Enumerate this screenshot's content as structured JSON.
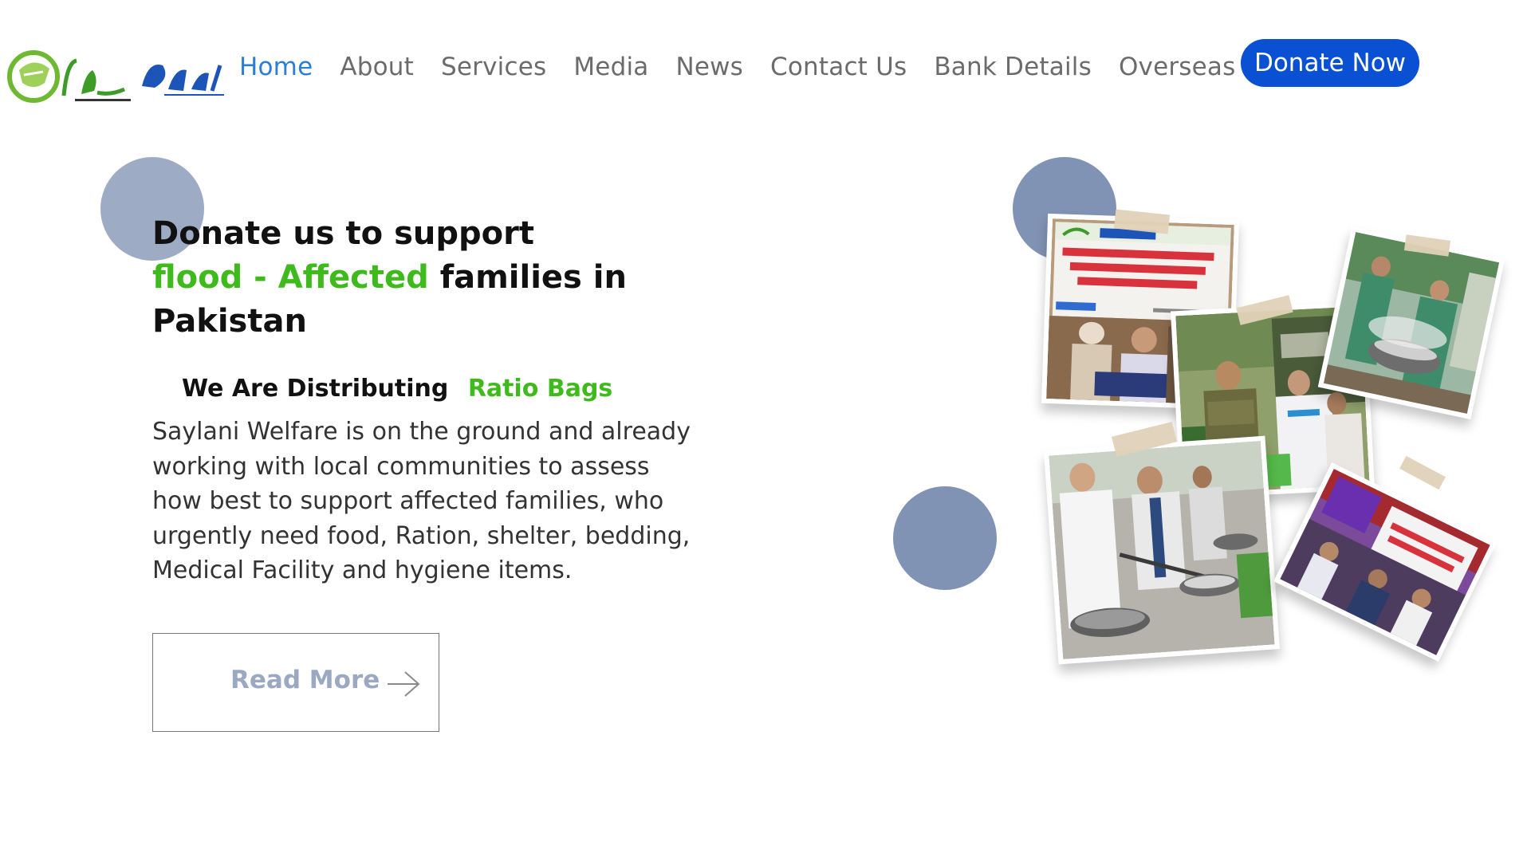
{
  "brand": {
    "logo_icon": "saylani-logo-icon"
  },
  "nav": {
    "items": [
      {
        "label": "Home",
        "active": true
      },
      {
        "label": "About",
        "active": false
      },
      {
        "label": "Services",
        "active": false
      },
      {
        "label": "Media",
        "active": false
      },
      {
        "label": "News",
        "active": false
      },
      {
        "label": "Contact Us",
        "active": false
      },
      {
        "label": "Bank Details",
        "active": false
      },
      {
        "label": "Overseas donor",
        "active": false
      }
    ],
    "donate_label": "Donate Now"
  },
  "hero": {
    "title_line1": "Donate us to support",
    "title_highlight": "flood - Affected",
    "title_line2_rest": " families in",
    "title_line3": "Pakistan",
    "sub_prefix": "We Are Distributing",
    "sub_highlight": "Ratio Bags",
    "body": "Saylani Welfare is on the ground and already working with local communities to assess how best to support affected families, who urgently need food, Ration, shelter, bedding, Medical Facility and hygiene items.",
    "read_more_label": "Read More",
    "read_more_icon": "arrow-right-icon"
  },
  "colors": {
    "accent_green": "#3fba1c",
    "nav_active": "#2a7fd4",
    "donate_bg": "#0a50d3",
    "circle": "#8193b4"
  }
}
